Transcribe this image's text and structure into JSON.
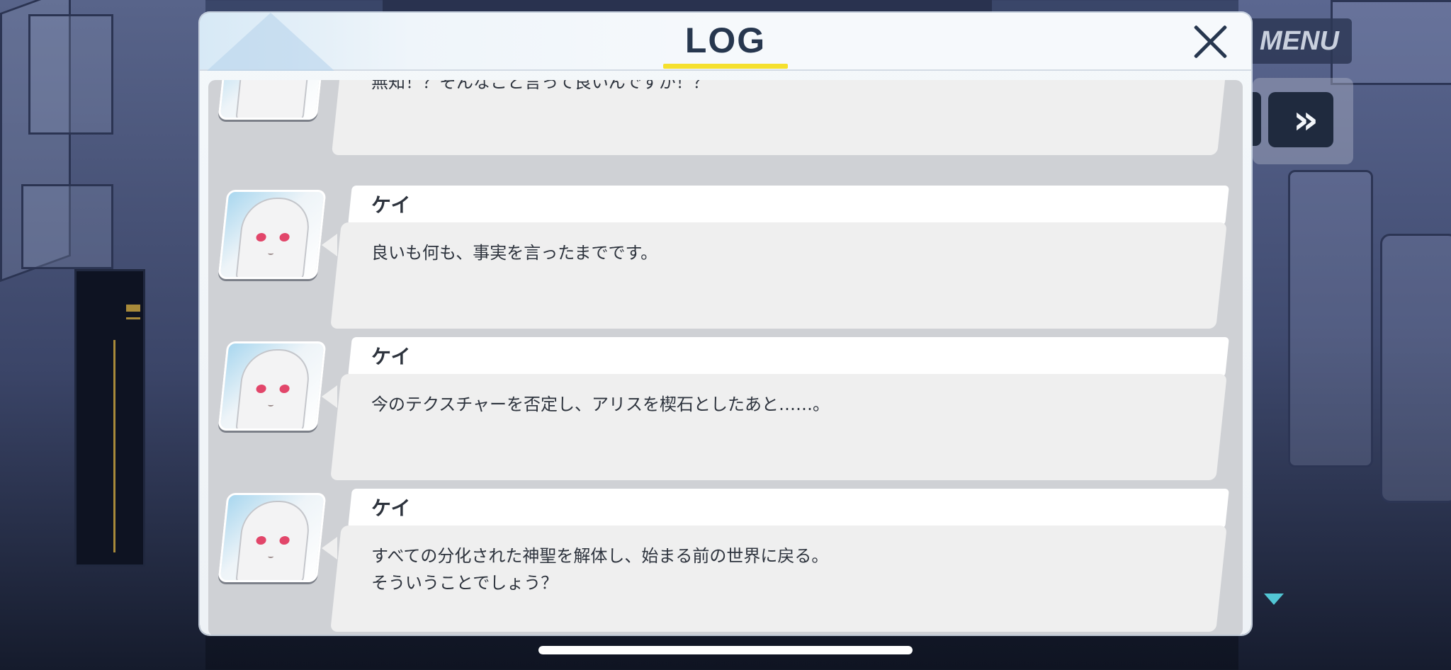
{
  "log": {
    "title": "LOG",
    "entries": [
      {
        "speaker": "",
        "lines": [
          "無知！？そんなこと言って良いんですか！？"
        ]
      },
      {
        "speaker": "ケイ",
        "lines": [
          "良いも何も、事実を言ったまでです。"
        ]
      },
      {
        "speaker": "ケイ",
        "lines": [
          "今のテクスチャーを否定し、アリスを楔石としたあと……。"
        ]
      },
      {
        "speaker": "ケイ",
        "lines": [
          "すべての分化された神聖を解体し、始まる前の世界に戻る。",
          "そういうことでしょう？"
        ]
      }
    ]
  },
  "hud": {
    "menu_label": "MENU",
    "fast_forward_label": "»",
    "fast_forward_icon": "fast-forward-icon",
    "next_icon": "triangle-down-icon"
  },
  "colors": {
    "accent": "#f5e02e",
    "title": "#27374f",
    "next_arrow": "#52c6d4"
  }
}
